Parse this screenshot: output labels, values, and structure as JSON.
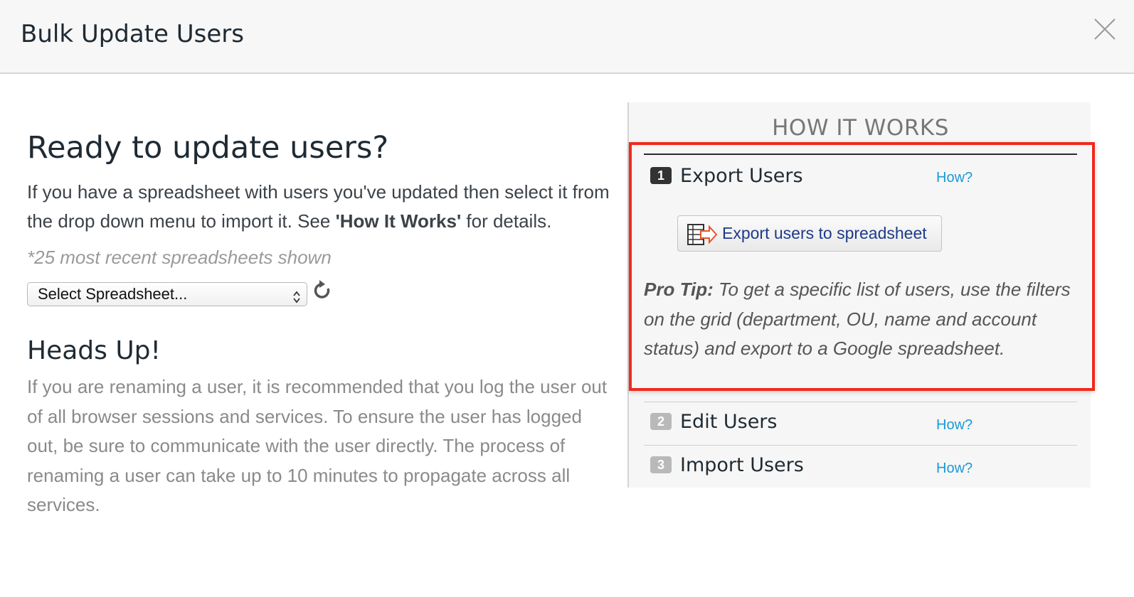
{
  "dialog": {
    "title": "Bulk Update Users",
    "close_icon": "close-icon"
  },
  "main": {
    "heading": "Ready to update users?",
    "intro_part1": "If you have a spreadsheet with users you've updated then select it from the drop down menu to import it. See ",
    "intro_bold": "'How It Works'",
    "intro_part2": " for details.",
    "recent_note": "*25 most recent spreadsheets shown",
    "select": {
      "selected_value": "Select Spreadsheet...",
      "arrows_icon": "chevron-up-down-icon"
    },
    "refresh_icon": "refresh-icon",
    "heads_up_heading": "Heads Up!",
    "heads_up_text": "If you are renaming a user, it is recommended that you log the user out of all browser sessions and services. To ensure the user has logged out, be sure to communicate with the user directly. The process of renaming a user can take up to 10 minutes to propagate across all services."
  },
  "how_it_works": {
    "title": "HOW IT WORKS",
    "steps": [
      {
        "number": "1",
        "label": "Export Users",
        "how_link": "How?"
      },
      {
        "number": "2",
        "label": "Edit Users",
        "how_link": "How?"
      },
      {
        "number": "3",
        "label": "Import Users",
        "how_link": "How?"
      }
    ],
    "export_button": {
      "label": "Export users to spreadsheet",
      "icon": "spreadsheet-export-icon"
    },
    "pro_tip_label": "Pro Tip:",
    "pro_tip_text": " To get a specific list of users, use the filters on the grid (department, OU, name and account status) and export to a Google spreadsheet."
  },
  "colors": {
    "highlight_border": "#f2291c",
    "link": "#1a9ad6",
    "export_label": "#1d3a8a"
  }
}
